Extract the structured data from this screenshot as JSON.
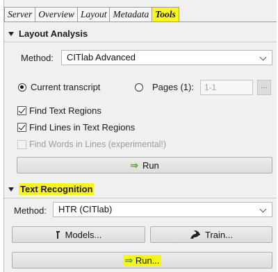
{
  "tabs": [
    {
      "label": "Server"
    },
    {
      "label": "Overview"
    },
    {
      "label": "Layout"
    },
    {
      "label": "Metadata"
    },
    {
      "label": "Tools"
    }
  ],
  "layout_analysis": {
    "title": "Layout Analysis",
    "method_label": "Method:",
    "method_value": "CITlab Advanced",
    "radio_current": "Current transcript",
    "radio_pages": "Pages (1):",
    "pages_input_value": "1-1",
    "pages_button": "...",
    "check_text_regions": "Find Text Regions",
    "check_lines": "Find Lines in Text Regions",
    "check_words": "Find Words in Lines (experimental!)",
    "run_arrow": "⇒",
    "run_label": "Run"
  },
  "text_recognition": {
    "title": "Text Recognition",
    "method_label": "Method:",
    "method_value": "HTR (CITlab)",
    "models_label": "Models...",
    "train_label": "Train...",
    "run_arrow": "⇒",
    "run_label": "Run..."
  },
  "colors": {
    "highlight": "#f8f41d",
    "run_arrow": "#6aa82d"
  }
}
